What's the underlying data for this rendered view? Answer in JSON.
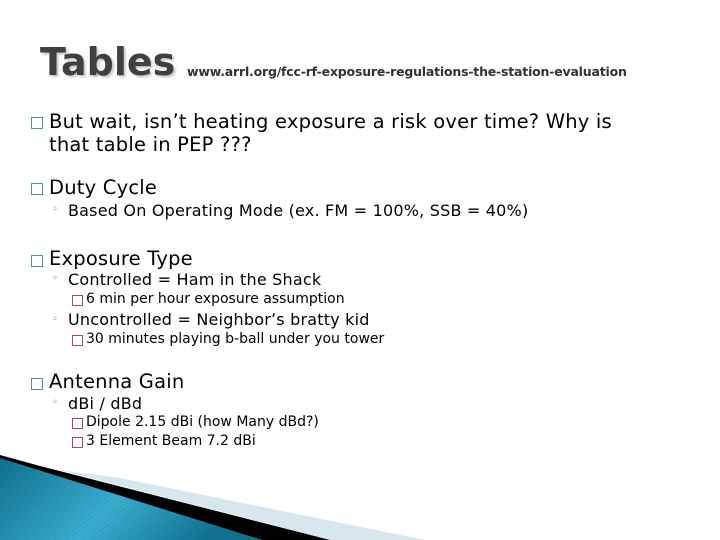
{
  "slide": {
    "title": "Tables",
    "url": "www.arrl.org/fcc-rf-exposure-regulations-the-station-evaluation",
    "colors": {
      "title": "#404040",
      "level1_bullet": "#4f8ea3",
      "level3_bullet": "#a34a55",
      "swoosh_teal": "#1b88a8",
      "swoosh_light": "#d6e7ee"
    }
  },
  "bullets": [
    {
      "text_line1": "But wait, isn’t heating exposure a risk over time?  Why is",
      "text_line2": "that table in PEP ???"
    },
    {
      "text": "Duty Cycle",
      "children": [
        {
          "text": "Based On Operating Mode (ex. FM = 100%, SSB = 40%)"
        }
      ]
    },
    {
      "text": "Exposure Type",
      "children": [
        {
          "text": "Controlled = Ham in the Shack",
          "children": [
            {
              "text": "6 min per hour exposure assumption"
            }
          ]
        },
        {
          "text": "Uncontrolled = Neighbor’s bratty kid",
          "children": [
            {
              "text": "30 minutes playing b-ball under you tower"
            }
          ]
        }
      ]
    },
    {
      "text": "Antenna Gain",
      "children": [
        {
          "text": "dBi / dBd",
          "children": [
            {
              "text": "Dipole 2.15 dBi (how Many dBd?)"
            },
            {
              "text": "3 Element Beam 7.2 dBi"
            }
          ]
        }
      ]
    }
  ]
}
